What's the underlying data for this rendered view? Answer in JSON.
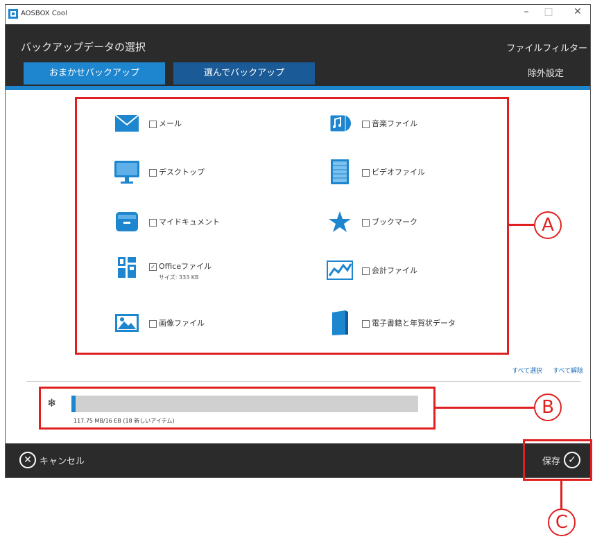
{
  "window": {
    "title": "AOSBOX Cool",
    "controls": {
      "minimize": "–",
      "maximize": "□",
      "close": "✕"
    }
  },
  "header": {
    "title": "バックアップデータの選択",
    "file_filter": "ファイルフィルター",
    "exclude_settings": "除外設定",
    "tabs": [
      {
        "label": "おまかせバックアップ",
        "active": true
      },
      {
        "label": "選んでバックアップ",
        "active": false
      }
    ]
  },
  "categories": [
    {
      "label": "メール",
      "checked": false,
      "icon": "mail-icon"
    },
    {
      "label": "音楽ファイル",
      "checked": false,
      "icon": "music-icon"
    },
    {
      "label": "デスクトップ",
      "checked": false,
      "icon": "monitor-icon"
    },
    {
      "label": "ビデオファイル",
      "checked": false,
      "icon": "video-icon"
    },
    {
      "label": "マイドキュメント",
      "checked": false,
      "icon": "document-box-icon"
    },
    {
      "label": "ブックマーク",
      "checked": false,
      "icon": "star-icon"
    },
    {
      "label": "Officeファイル",
      "checked": true,
      "icon": "office-icon",
      "size": "サイズ: 333 KB"
    },
    {
      "label": "会計ファイル",
      "checked": false,
      "icon": "chart-icon"
    },
    {
      "label": "画像ファイル",
      "checked": false,
      "icon": "image-icon"
    },
    {
      "label": "電子書籍と年賀状データ",
      "checked": false,
      "icon": "book-icon"
    }
  ],
  "selection_links": {
    "select_all": "すべて選択",
    "deselect_all": "すべて解除"
  },
  "progress": {
    "text": "117.75 MB/16 EB (18 新しいアイテム)",
    "fraction": 0.01,
    "icon": "snowflake-icon"
  },
  "footer": {
    "cancel": "キャンセル",
    "save": "保存"
  },
  "callouts": {
    "a": "A",
    "b": "B",
    "c": "C"
  },
  "colors": {
    "accent": "#1d86cf",
    "header_bg": "#2b2b2b",
    "annotation": "#e02020"
  }
}
